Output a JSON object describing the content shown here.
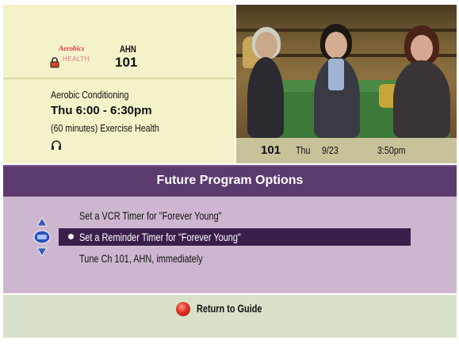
{
  "channel": {
    "logo_text_top": "Aerobics",
    "logo_text_bottom": "HEALTH",
    "callsign": "AHN",
    "number": "101"
  },
  "program": {
    "title": "Aerobic Conditioning",
    "time": "Thu 6:00 - 6:30pm",
    "description": "(60 minutes) Exercise Health"
  },
  "video_status": {
    "channel": "101",
    "day": "Thu",
    "date": "9/23",
    "time": "3:50pm"
  },
  "title_bar": {
    "title": "Future Program Options"
  },
  "options": [
    {
      "label": "Set a VCR Timer for \"Forever Young\""
    },
    {
      "label": "Set a Reminder Timer for \"Forever Young\"",
      "selected": true
    },
    {
      "label": "Tune Ch 101, AHN, immediately"
    }
  ],
  "footer": {
    "button_icon": "red-button-icon",
    "label": "Return to Guide"
  },
  "colors": {
    "info_bg": "#f4f2c9",
    "title_bar": "#5b3a6e",
    "options_bg": "#cdb7d0",
    "selected_row": "#3a1f4a",
    "footer_bg": "#d8e2cb"
  }
}
